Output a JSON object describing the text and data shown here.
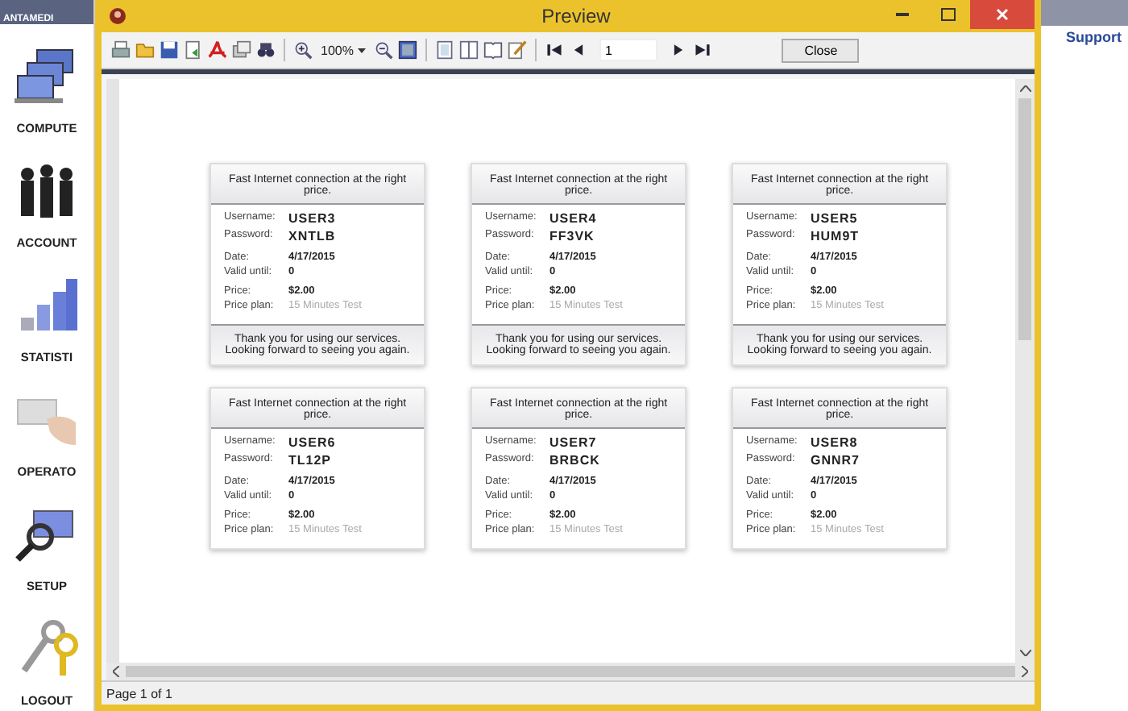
{
  "app": {
    "logo": "ANTAMEDI",
    "support_link": "Support",
    "nav": [
      {
        "label": "COMPUTE"
      },
      {
        "label": "ACCOUNT"
      },
      {
        "label": "STATISTI"
      },
      {
        "label": "OPERATO"
      },
      {
        "label": "SETUP"
      },
      {
        "label": "LOGOUT"
      }
    ]
  },
  "window": {
    "title": "Preview"
  },
  "toolbar": {
    "items": [
      {
        "kind": "icon"
      },
      {
        "kind": "icon"
      },
      {
        "kind": "icon"
      },
      {
        "kind": "icon"
      },
      {
        "kind": "icon"
      },
      {
        "kind": "icon"
      },
      {
        "kind": "icon"
      },
      {
        "kind": "separator"
      },
      {
        "kind": "icon"
      },
      {
        "kind": "zoom",
        "value": "100%"
      },
      {
        "kind": "icon"
      },
      {
        "kind": "icon"
      },
      {
        "kind": "separator"
      },
      {
        "kind": "icon"
      },
      {
        "kind": "icon"
      },
      {
        "kind": "icon"
      },
      {
        "kind": "icon"
      },
      {
        "kind": "separator"
      },
      {
        "kind": "icon"
      },
      {
        "kind": "icon"
      },
      {
        "kind": "page",
        "value": "1"
      },
      {
        "kind": "icon"
      },
      {
        "kind": "icon"
      },
      {
        "kind": "button",
        "label": "Close"
      }
    ]
  },
  "cards": [
    {
      "header": "Fast Internet connection at the right price.",
      "groups": [
        [
          {
            "label": "Username:",
            "value": "USER3",
            "kind": "credential"
          },
          {
            "label": "Password:",
            "value": "XNTLB",
            "kind": "credential"
          }
        ],
        [
          {
            "label": "Date:",
            "value": "4/17/2015",
            "kind": "plain"
          },
          {
            "label": "Valid until:",
            "value": "0",
            "kind": "plain"
          }
        ],
        [
          {
            "label": "Price:",
            "value": "$2.00",
            "kind": "plain"
          },
          {
            "label": "Price plan:",
            "value": "15 Minutes Test",
            "kind": "muted"
          }
        ]
      ],
      "footer": "Thank you for using our services. Looking forward to seeing you again."
    },
    {
      "header": "Fast Internet connection at the right price.",
      "groups": [
        [
          {
            "label": "Username:",
            "value": "USER4",
            "kind": "credential"
          },
          {
            "label": "Password:",
            "value": "FF3VK",
            "kind": "credential"
          }
        ],
        [
          {
            "label": "Date:",
            "value": "4/17/2015",
            "kind": "plain"
          },
          {
            "label": "Valid until:",
            "value": "0",
            "kind": "plain"
          }
        ],
        [
          {
            "label": "Price:",
            "value": "$2.00",
            "kind": "plain"
          },
          {
            "label": "Price plan:",
            "value": "15 Minutes Test",
            "kind": "muted"
          }
        ]
      ],
      "footer": "Thank you for using our services. Looking forward to seeing you again."
    },
    {
      "header": "Fast Internet connection at the right price.",
      "groups": [
        [
          {
            "label": "Username:",
            "value": "USER5",
            "kind": "credential"
          },
          {
            "label": "Password:",
            "value": "HUM9T",
            "kind": "credential"
          }
        ],
        [
          {
            "label": "Date:",
            "value": "4/17/2015",
            "kind": "plain"
          },
          {
            "label": "Valid until:",
            "value": "0",
            "kind": "plain"
          }
        ],
        [
          {
            "label": "Price:",
            "value": "$2.00",
            "kind": "plain"
          },
          {
            "label": "Price plan:",
            "value": "15 Minutes Test",
            "kind": "muted"
          }
        ]
      ],
      "footer": "Thank you for using our services. Looking forward to seeing you again."
    },
    {
      "header": "Fast Internet connection at the right price.",
      "groups": [
        [
          {
            "label": "Username:",
            "value": "USER6",
            "kind": "credential"
          },
          {
            "label": "Password:",
            "value": "TL12P",
            "kind": "credential"
          }
        ],
        [
          {
            "label": "Date:",
            "value": "4/17/2015",
            "kind": "plain"
          },
          {
            "label": "Valid until:",
            "value": "0",
            "kind": "plain"
          }
        ],
        [
          {
            "label": "Price:",
            "value": "$2.00",
            "kind": "plain"
          },
          {
            "label": "Price plan:",
            "value": "15 Minutes Test",
            "kind": "muted"
          }
        ]
      ]
    },
    {
      "header": "Fast Internet connection at the right price.",
      "groups": [
        [
          {
            "label": "Username:",
            "value": "USER7",
            "kind": "credential"
          },
          {
            "label": "Password:",
            "value": "BRBCK",
            "kind": "credential"
          }
        ],
        [
          {
            "label": "Date:",
            "value": "4/17/2015",
            "kind": "plain"
          },
          {
            "label": "Valid until:",
            "value": "0",
            "kind": "plain"
          }
        ],
        [
          {
            "label": "Price:",
            "value": "$2.00",
            "kind": "plain"
          },
          {
            "label": "Price plan:",
            "value": "15 Minutes Test",
            "kind": "muted"
          }
        ]
      ]
    },
    {
      "header": "Fast Internet connection at the right price.",
      "groups": [
        [
          {
            "label": "Username:",
            "value": "USER8",
            "kind": "credential"
          },
          {
            "label": "Password:",
            "value": "GNNR7",
            "kind": "credential"
          }
        ],
        [
          {
            "label": "Date:",
            "value": "4/17/2015",
            "kind": "plain"
          },
          {
            "label": "Valid until:",
            "value": "0",
            "kind": "plain"
          }
        ],
        [
          {
            "label": "Price:",
            "value": "$2.00",
            "kind": "plain"
          },
          {
            "label": "Price plan:",
            "value": "15 Minutes Test",
            "kind": "muted"
          }
        ]
      ]
    }
  ],
  "status_bar": {
    "text": "Page 1 of 1"
  }
}
